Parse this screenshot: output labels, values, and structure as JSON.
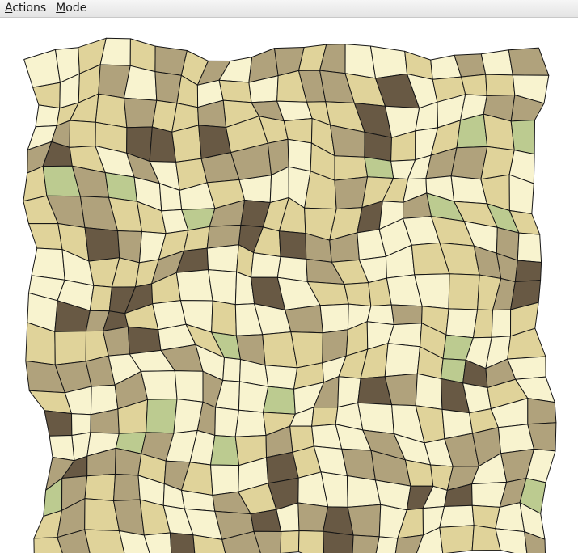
{
  "menubar": {
    "items": [
      {
        "mnemonic": "A",
        "rest": "ctions"
      },
      {
        "mnemonic": "M",
        "rest": "ode"
      }
    ]
  },
  "tiling": {
    "palette": {
      "light": "#f8f3cf",
      "medium": "#e0d39a",
      "tan": "#b0a27c",
      "dark": "#685944",
      "green": "#bccb90",
      "stroke": "#151515"
    }
  }
}
